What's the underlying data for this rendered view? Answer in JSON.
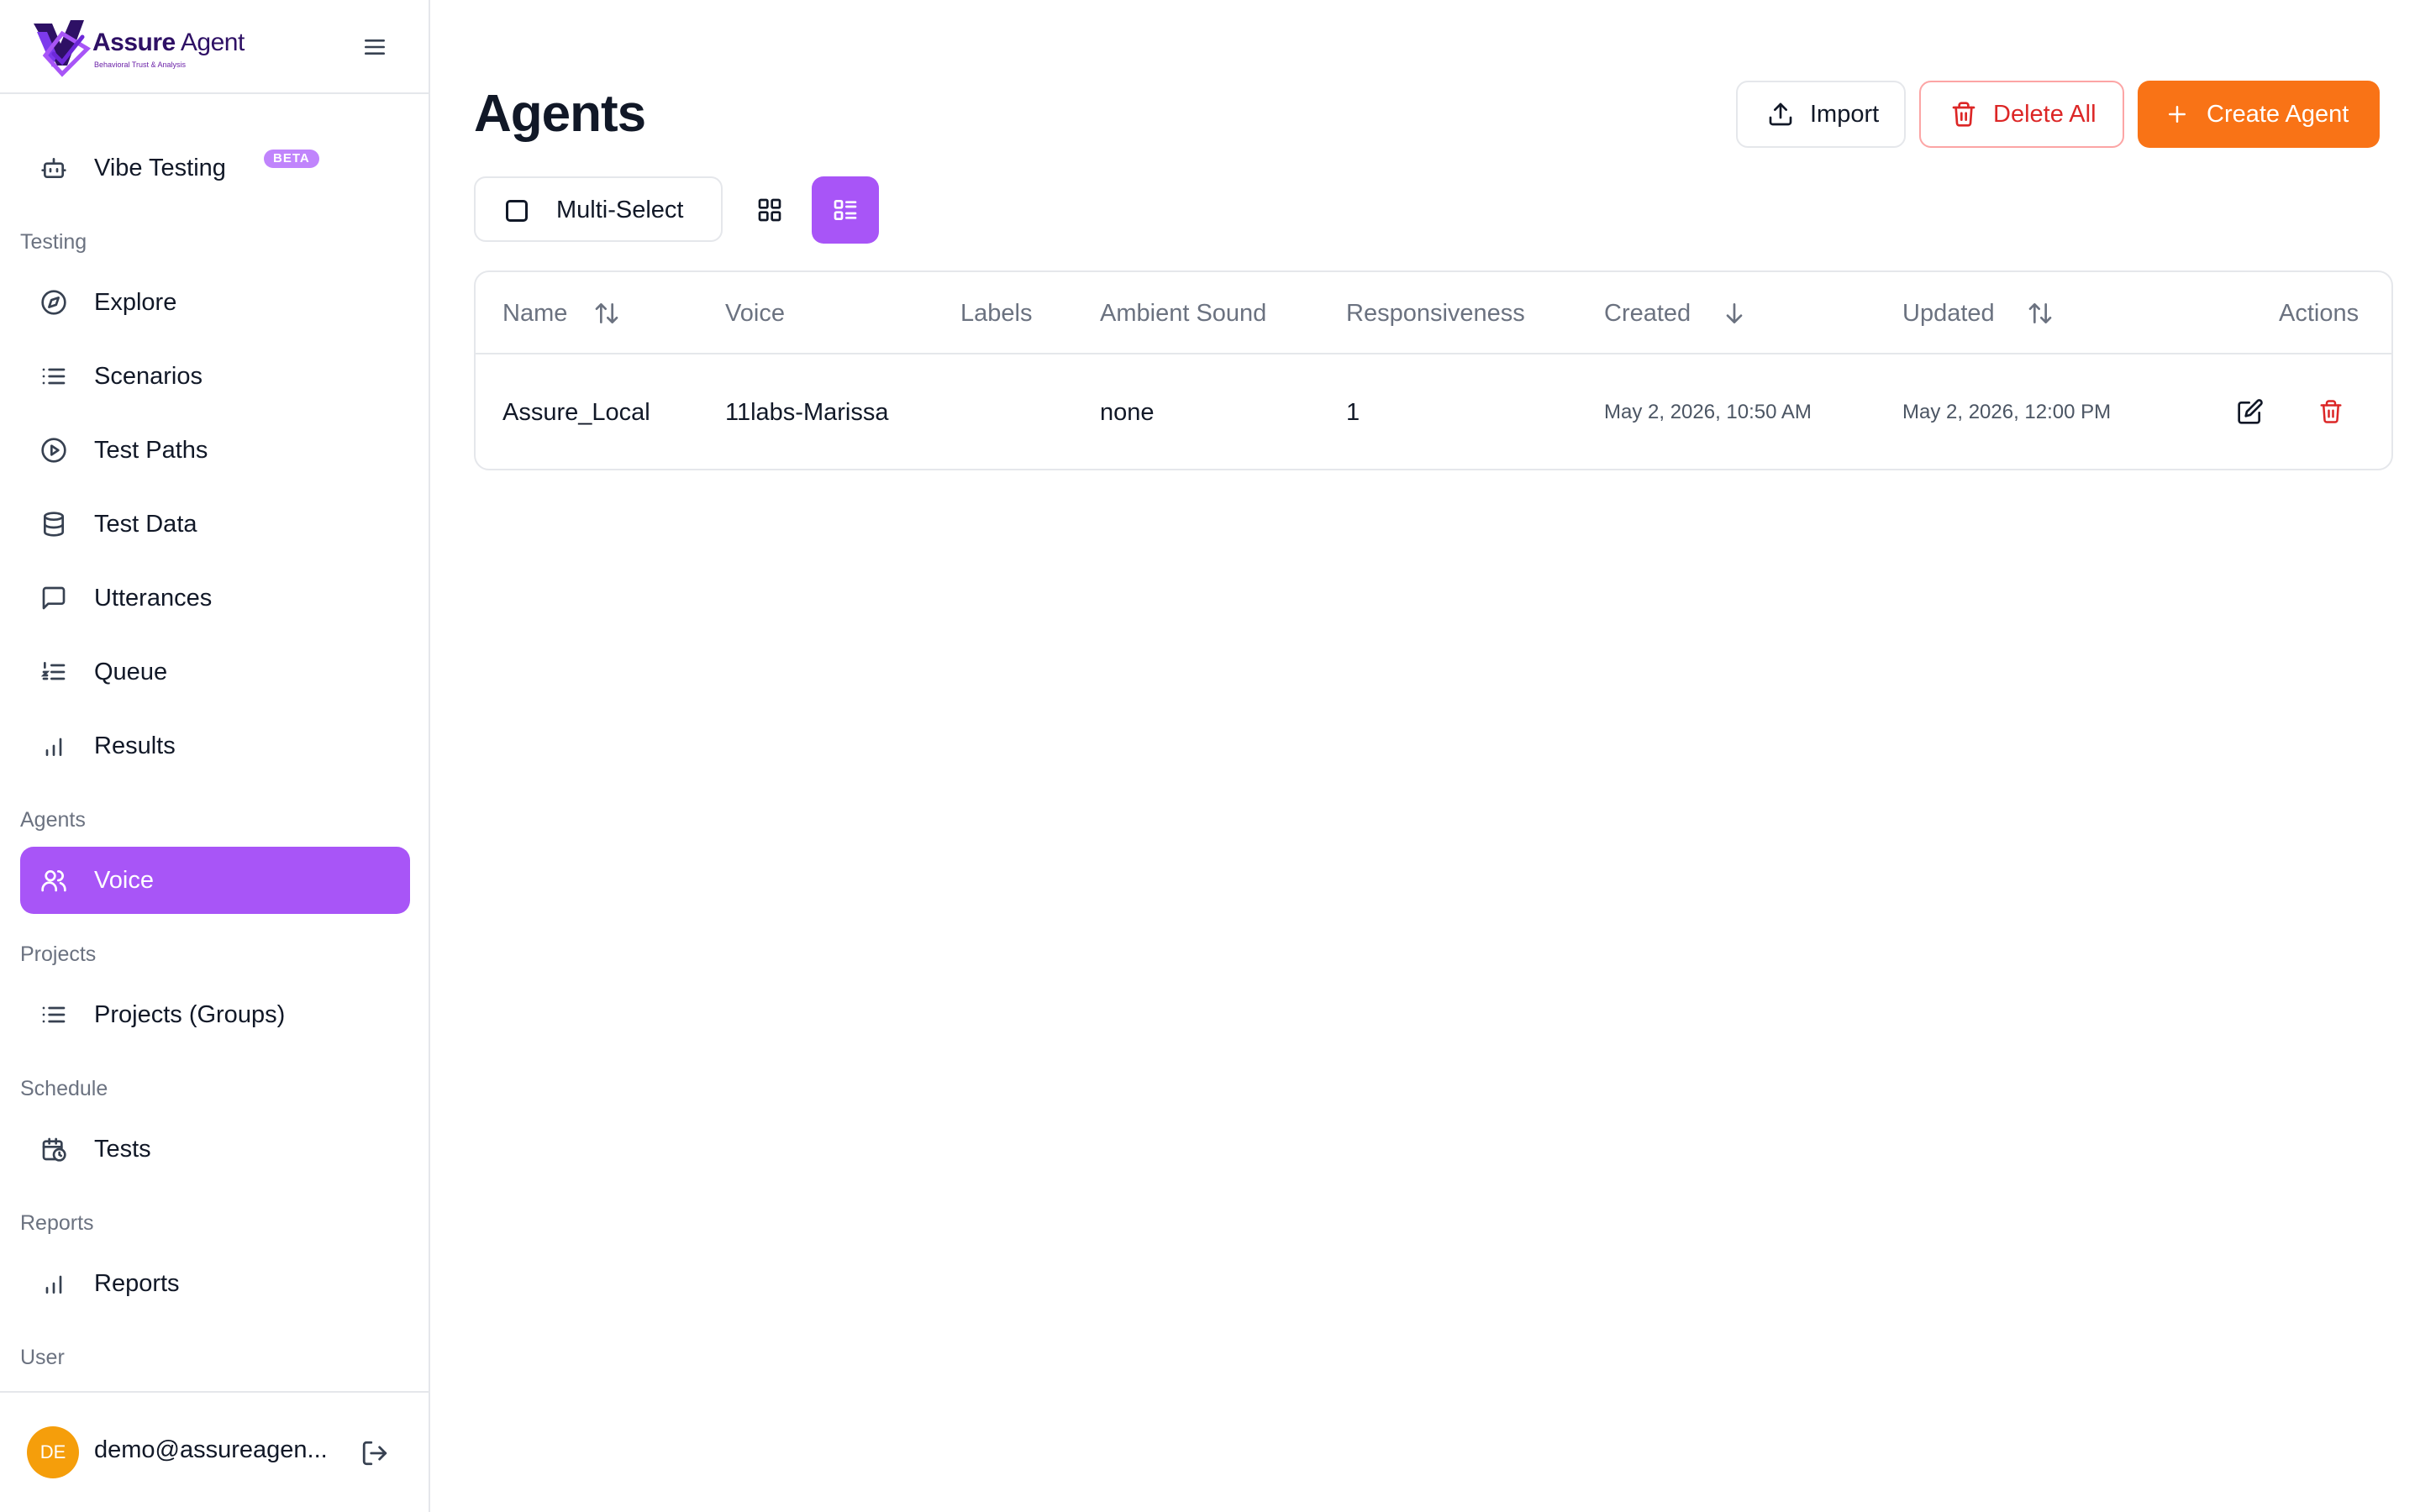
{
  "brand": {
    "name_bold": "Assure",
    "name_light": " Agent",
    "tagline": "Behavioral Trust & Analysis",
    "accent": "#a855f7",
    "dark": "#2e1065"
  },
  "sidebar": {
    "vibe": {
      "label": "Vibe Testing",
      "badge": "BETA",
      "icon": "robot-icon"
    },
    "sections": {
      "testing": "Testing",
      "agents": "Agents",
      "projects": "Projects",
      "schedule": "Schedule",
      "reports": "Reports",
      "user": "User"
    },
    "items": {
      "explore": "Explore",
      "scenarios": "Scenarios",
      "test_paths": "Test Paths",
      "test_data": "Test Data",
      "utterances": "Utterances",
      "queue": "Queue",
      "results": "Results",
      "voice": "Voice",
      "projects_groups": "Projects (Groups)",
      "tests": "Tests",
      "reports": "Reports"
    },
    "active_item": "voice"
  },
  "user": {
    "initials": "DE",
    "email": "demo@assureagen...",
    "avatar_color": "#f59e0b"
  },
  "main": {
    "title": "Agents",
    "buttons": {
      "import": "Import",
      "delete_all": "Delete All",
      "create_agent": "Create Agent"
    },
    "multi_select": "Multi-Select",
    "active_view": "list",
    "colors": {
      "create": "#f97316",
      "delete": "#dc2626"
    }
  },
  "table": {
    "columns": {
      "name": "Name",
      "voice": "Voice",
      "labels": "Labels",
      "ambient": "Ambient Sound",
      "responsiveness": "Responsiveness",
      "created": "Created",
      "updated": "Updated",
      "actions": "Actions"
    },
    "rows": [
      {
        "name": "Assure_Local",
        "voice": "11labs-Marissa",
        "labels": "",
        "ambient": "none",
        "responsiveness": "1",
        "created": "May 2, 2026, 10:50 AM",
        "updated": "May 2, 2026, 12:00 PM"
      }
    ]
  }
}
